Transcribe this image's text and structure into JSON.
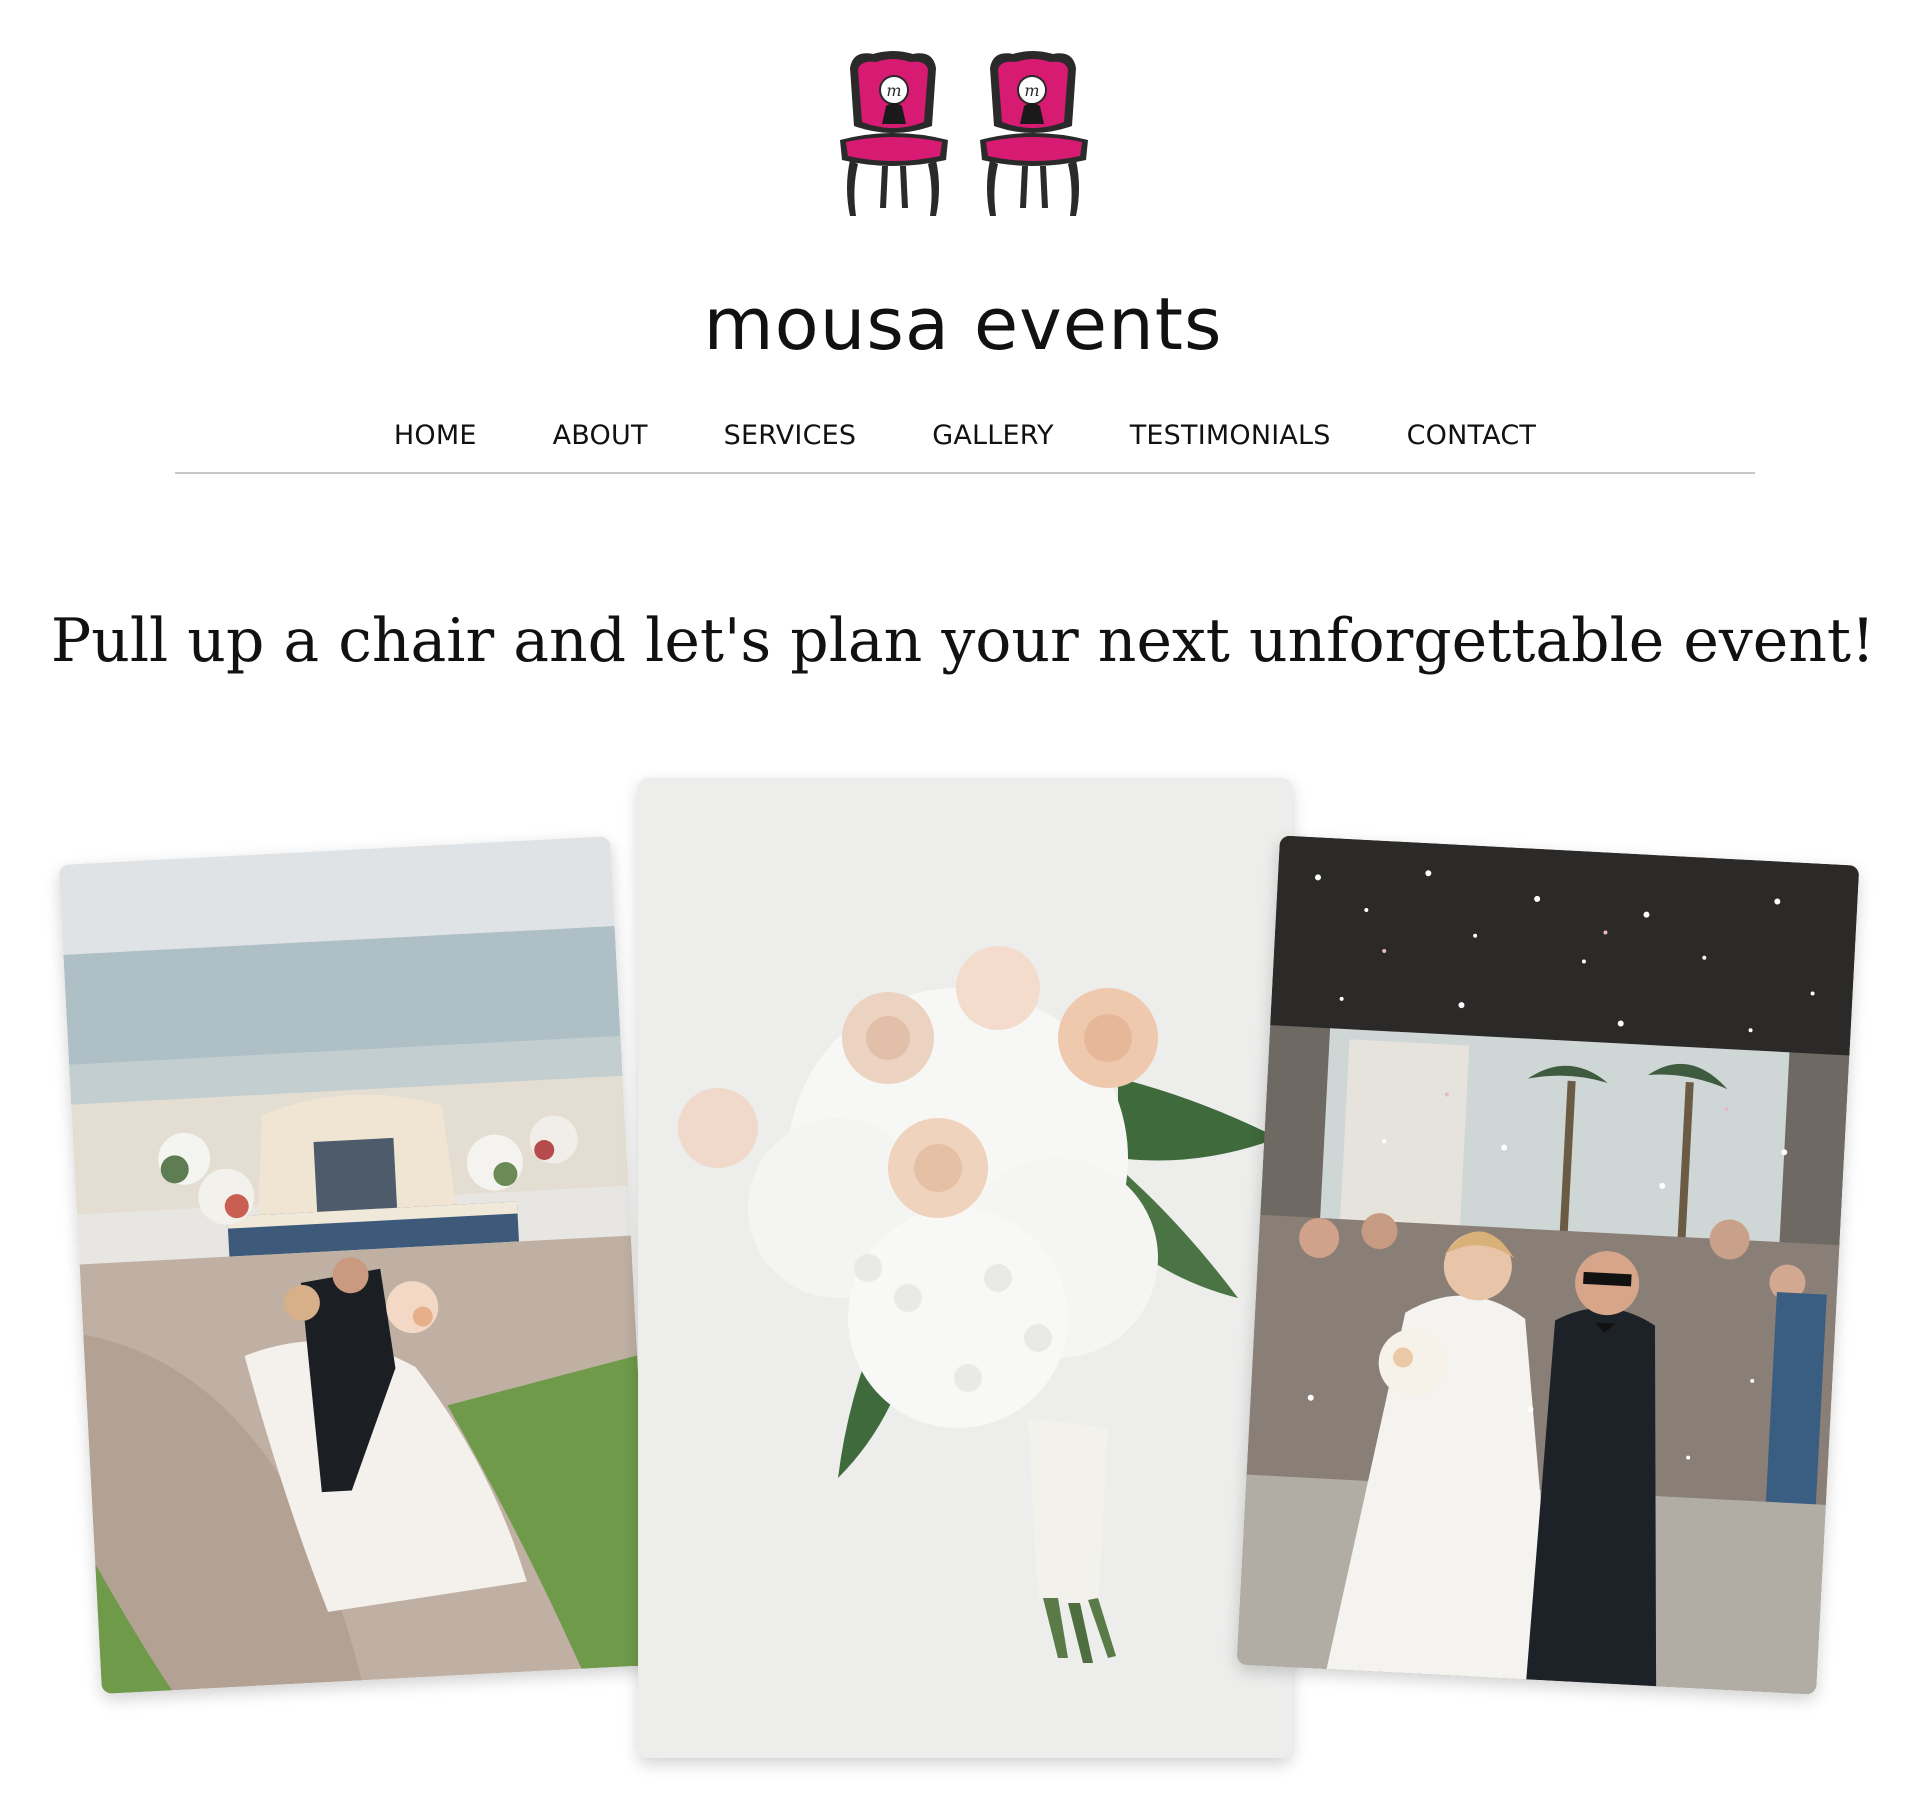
{
  "brand": {
    "name": "mousa events",
    "logo_icon": "chairs-logo-icon",
    "logo_letter": "m",
    "accent_color": "#d81b72"
  },
  "nav": {
    "items": [
      {
        "label": "HOME"
      },
      {
        "label": "ABOUT"
      },
      {
        "label": "SERVICES"
      },
      {
        "label": "GALLERY"
      },
      {
        "label": "TESTIMONIALS"
      },
      {
        "label": "CONTACT"
      }
    ]
  },
  "hero": {
    "headline": "Pull up a chair and let's plan your next unforgettable event!"
  },
  "gallery": {
    "photos": [
      {
        "subject": "wedding-couple-kiss-photo"
      },
      {
        "subject": "bridal-bouquet-photo"
      },
      {
        "subject": "confetti-exit-photo"
      }
    ]
  }
}
